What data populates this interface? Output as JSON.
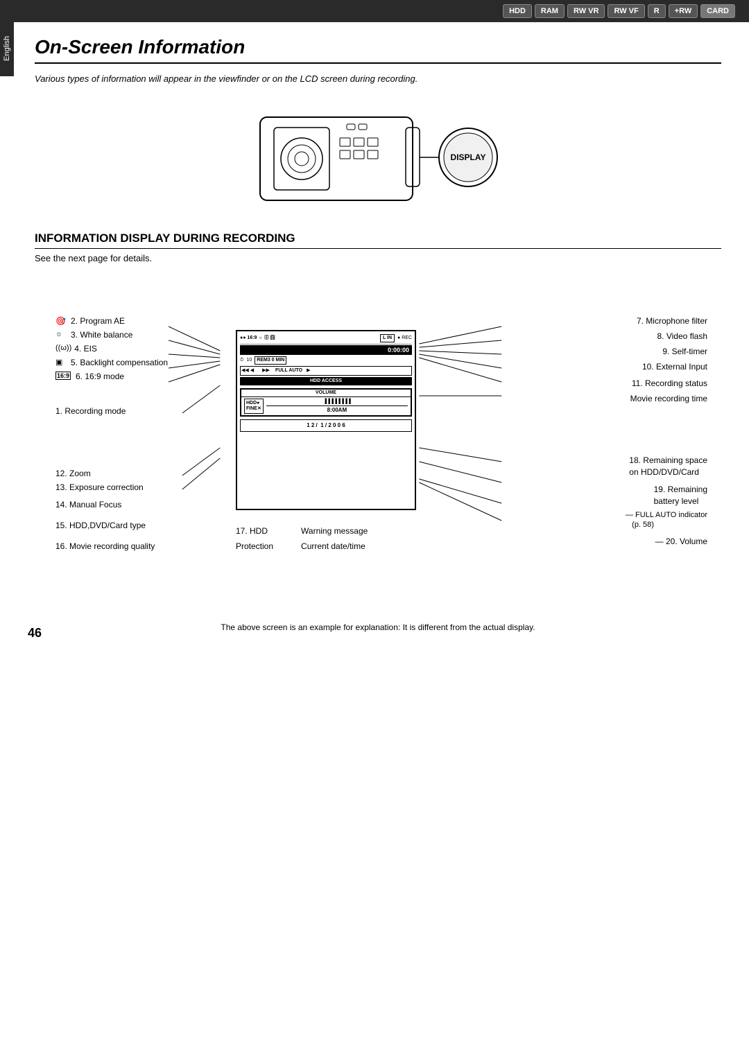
{
  "topNav": {
    "badges": [
      "HDD",
      "RAM",
      "RW VR",
      "RW VF",
      "R",
      "+RW",
      "CARD"
    ]
  },
  "sideTab": "English",
  "pageTitle": "On-Screen Information",
  "subtitleText": "Various types of information will appear in the viewfinder or on the LCD screen during recording.",
  "sectionHeading": "INFORMATION DISPLAY DURING RECORDING",
  "seeNextText": "See the next page for details.",
  "leftItems": [
    {
      "num": "2.",
      "icon": "🎯",
      "label": "Program AE"
    },
    {
      "num": "3.",
      "icon": "☀",
      "label": "White balance"
    },
    {
      "num": "4.",
      "icon": "((ω))",
      "label": "EIS"
    },
    {
      "num": "5.",
      "icon": "⬛",
      "label": "Backlight compensation"
    },
    {
      "num": "6.",
      "icon": "16:9",
      "label": "16:9 mode"
    }
  ],
  "recordingModeLabel": "1. Recording mode",
  "zoomLabel": "12. Zoom",
  "exposureLabel": "13. Exposure correction",
  "manualFocusLabel": "14. Manual Focus",
  "hddDvdLabel": "15. HDD,DVD/Card type",
  "movieQualityLabel": "16. Movie recording quality",
  "hddProtLabel": "17. HDD\nProtection",
  "warningLabel": "Warning message",
  "dateTimeLabel": "Current date/time",
  "rightItems": [
    {
      "num": "7.",
      "label": "Microphone filter"
    },
    {
      "num": "8.",
      "label": "Video flash"
    },
    {
      "num": "9.",
      "label": "Self-timer"
    },
    {
      "num": "10.",
      "label": "External Input"
    },
    {
      "num": "11.",
      "label": "Recording status"
    },
    {
      "num": "18.",
      "label": "Remaining space\non HDD/DVD/Card"
    },
    {
      "num": "19.",
      "label": "Remaining\nbattery level"
    },
    {
      "num": "FULL AUTO",
      "label": "indicator\n(p. 58)"
    },
    {
      "num": "20.",
      "label": "Volume"
    }
  ],
  "movieRecordingTimeLabel": "Movie recording time",
  "screenData": {
    "row1": "●● 16:9 ☆ ⑤ 囧  L IN  ● REC",
    "timecode": "0:00:00",
    "row2": "⏱10  REM3 0 MIN",
    "row3": "◀◀  ◀  ▶▶  FULL AUTO",
    "row4": "HDD  ACCESS",
    "volumeLabel": "VOLUME",
    "volumeBar": "||||||||",
    "hddBox": "HDD●\nFINEX",
    "time": "8:00AM",
    "date": "12/  1/2006"
  },
  "noteText": "The above screen is an example for explanation:\nIt is different from the actual display.",
  "pageNumber": "46"
}
